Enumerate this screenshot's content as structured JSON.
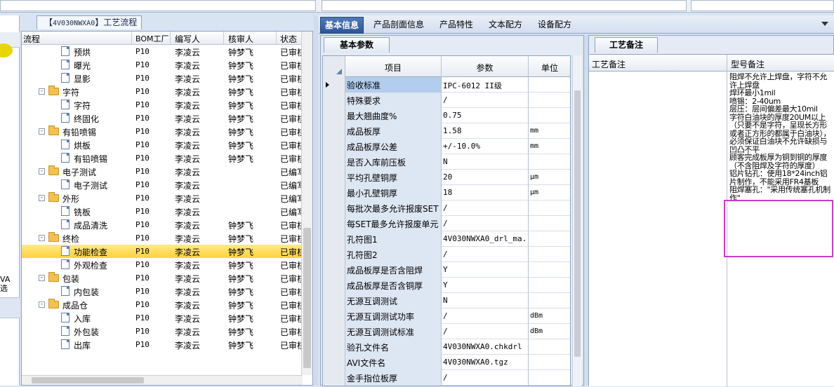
{
  "left_tab": {
    "code": "4V030NWXA0",
    "title": "工艺流程"
  },
  "left_fragment": {
    "text": "VA\n选"
  },
  "tree": {
    "columns": [
      "流程",
      "BOM工厂",
      "编写人",
      "核审人",
      "状态"
    ],
    "rows": [
      {
        "name": "预烘",
        "level": 2,
        "type": "doc",
        "factory": "P10",
        "writer": "李凌云",
        "reviewer": "钟梦飞",
        "status": "已审核"
      },
      {
        "name": "曝光",
        "level": 2,
        "type": "doc",
        "factory": "P10",
        "writer": "李凌云",
        "reviewer": "钟梦飞",
        "status": "已审核"
      },
      {
        "name": "显影",
        "level": 2,
        "type": "doc",
        "factory": "P10",
        "writer": "李凌云",
        "reviewer": "钟梦飞",
        "status": "已审核"
      },
      {
        "name": "字符",
        "level": 1,
        "type": "folder",
        "factory": "P10",
        "writer": "李凌云",
        "reviewer": "钟梦飞",
        "status": "已审核"
      },
      {
        "name": "字符",
        "level": 2,
        "type": "doc",
        "factory": "P10",
        "writer": "李凌云",
        "reviewer": "钟梦飞",
        "status": "已审核"
      },
      {
        "name": "终固化",
        "level": 2,
        "type": "doc",
        "factory": "P10",
        "writer": "李凌云",
        "reviewer": "钟梦飞",
        "status": "已审核"
      },
      {
        "name": "有铅喷锡",
        "level": 1,
        "type": "folder",
        "factory": "P10",
        "writer": "李凌云",
        "reviewer": "钟梦飞",
        "status": "已审核"
      },
      {
        "name": "烘板",
        "level": 2,
        "type": "doc",
        "factory": "P10",
        "writer": "李凌云",
        "reviewer": "钟梦飞",
        "status": "已审核"
      },
      {
        "name": "有铅喷锡",
        "level": 2,
        "type": "doc",
        "factory": "P10",
        "writer": "李凌云",
        "reviewer": "钟梦飞",
        "status": "已审核"
      },
      {
        "name": "电子测试",
        "level": 1,
        "type": "folder",
        "factory": "P10",
        "writer": "李凌云",
        "reviewer": "",
        "status": "已编写"
      },
      {
        "name": "电子测试",
        "level": 2,
        "type": "doc",
        "factory": "P10",
        "writer": "李凌云",
        "reviewer": "",
        "status": "已编写"
      },
      {
        "name": "外形",
        "level": 1,
        "type": "folder",
        "factory": "P10",
        "writer": "李凌云",
        "reviewer": "",
        "status": "已编写"
      },
      {
        "name": "铣板",
        "level": 2,
        "type": "doc",
        "factory": "P10",
        "writer": "李凌云",
        "reviewer": "",
        "status": "已编写"
      },
      {
        "name": "成品清洗",
        "level": 2,
        "type": "doc",
        "factory": "P10",
        "writer": "李凌云",
        "reviewer": "钟梦飞",
        "status": "已审核"
      },
      {
        "name": "终检",
        "level": 1,
        "type": "folder",
        "factory": "P10",
        "writer": "李凌云",
        "reviewer": "钟梦飞",
        "status": "已审核"
      },
      {
        "name": "功能检查",
        "level": 2,
        "type": "doc",
        "factory": "P10",
        "writer": "李凌云",
        "reviewer": "钟梦飞",
        "status": "已审核",
        "selected": true
      },
      {
        "name": "外观检查",
        "level": 2,
        "type": "doc",
        "factory": "P10",
        "writer": "李凌云",
        "reviewer": "钟梦飞",
        "status": "已审核"
      },
      {
        "name": "包装",
        "level": 1,
        "type": "folder",
        "factory": "P10",
        "writer": "李凌云",
        "reviewer": "钟梦飞",
        "status": "已审核"
      },
      {
        "name": "内包装",
        "level": 2,
        "type": "doc",
        "factory": "P10",
        "writer": "李凌云",
        "reviewer": "钟梦飞",
        "status": "已审核"
      },
      {
        "name": "成品仓",
        "level": 1,
        "type": "folder",
        "factory": "P10",
        "writer": "李凌云",
        "reviewer": "钟梦飞",
        "status": "已审核"
      },
      {
        "name": "入库",
        "level": 2,
        "type": "doc",
        "factory": "P10",
        "writer": "李凌云",
        "reviewer": "钟梦飞",
        "status": "已审核"
      },
      {
        "name": "外包装",
        "level": 2,
        "type": "doc",
        "factory": "P10",
        "writer": "李凌云",
        "reviewer": "钟梦飞",
        "status": "已审核"
      },
      {
        "name": "出库",
        "level": 2,
        "type": "doc",
        "factory": "P10",
        "writer": "李凌云",
        "reviewer": "钟梦飞",
        "status": "已审核"
      }
    ]
  },
  "top_tabs": [
    "基本信息",
    "产品剖面信息",
    "产品特性",
    "文本配方",
    "设备配方"
  ],
  "params": {
    "tab": "基本参数",
    "columns": [
      "项目",
      "参数",
      "单位"
    ],
    "rows": [
      {
        "item": "验收标准",
        "value": "IPC-6012 II级",
        "unit": "",
        "selected": true
      },
      {
        "item": "特殊要求",
        "value": "/",
        "unit": ""
      },
      {
        "item": "最大翘曲度%",
        "value": "0.75",
        "unit": ""
      },
      {
        "item": "成品板厚",
        "value": "1.58",
        "unit": "mm"
      },
      {
        "item": "成品板厚公差",
        "value": "+/-10.0%",
        "unit": "mm"
      },
      {
        "item": "是否入库前压板",
        "value": "N",
        "unit": ""
      },
      {
        "item": "平均孔壁铜厚",
        "value": "20",
        "unit": "μm"
      },
      {
        "item": "最小孔壁铜厚",
        "value": "18",
        "unit": "μm"
      },
      {
        "item": "每批次最多允许报废SET",
        "value": "/",
        "unit": ""
      },
      {
        "item": "每SET最多允许报废单元",
        "value": "/",
        "unit": ""
      },
      {
        "item": "孔符图1",
        "value": "4V030NWXA0_drl_ma...",
        "unit": ""
      },
      {
        "item": "孔符图2",
        "value": "/",
        "unit": ""
      },
      {
        "item": "成品板厚是否含阻焊",
        "value": "Y",
        "unit": ""
      },
      {
        "item": "成品板厚是否含铜厚",
        "value": "Y",
        "unit": ""
      },
      {
        "item": "无源互调测试",
        "value": "N",
        "unit": ""
      },
      {
        "item": "无源互调测试功率",
        "value": "/",
        "unit": "dBm"
      },
      {
        "item": "无源互调测试标准",
        "value": "/",
        "unit": "dBm"
      },
      {
        "item": "验孔文件名",
        "value": "4V030NWXA0.chkdrl",
        "unit": ""
      },
      {
        "item": "AVI文件名",
        "value": "4V030NWXA0.tgz",
        "unit": ""
      },
      {
        "item": "金手指位板厚",
        "value": "/",
        "unit": ""
      }
    ]
  },
  "notes": {
    "tab": "工艺备注",
    "col1": "工艺备注",
    "col2": "型号备注",
    "memo": "阻焊不允许上焊盘，字符不允许上焊盘\n焊环最小1mil\n喷锡：2-40um\n层压：层间偏差最大10mil\n字符白油块的厚度20UM以上（只要不是字符，呈现长方形或者正方形的都属于白油块），必须保证白油块不允许缺损与凹凸不平\n顾客完成板厚为铜到铜的厚度（不含阻焊及字符的厚度）\n铝片钻孔：使用18*24inch铝片制作，不能采用FR4基板\n阻焊塞孔：\"采用传统塞孔机制作\""
  }
}
